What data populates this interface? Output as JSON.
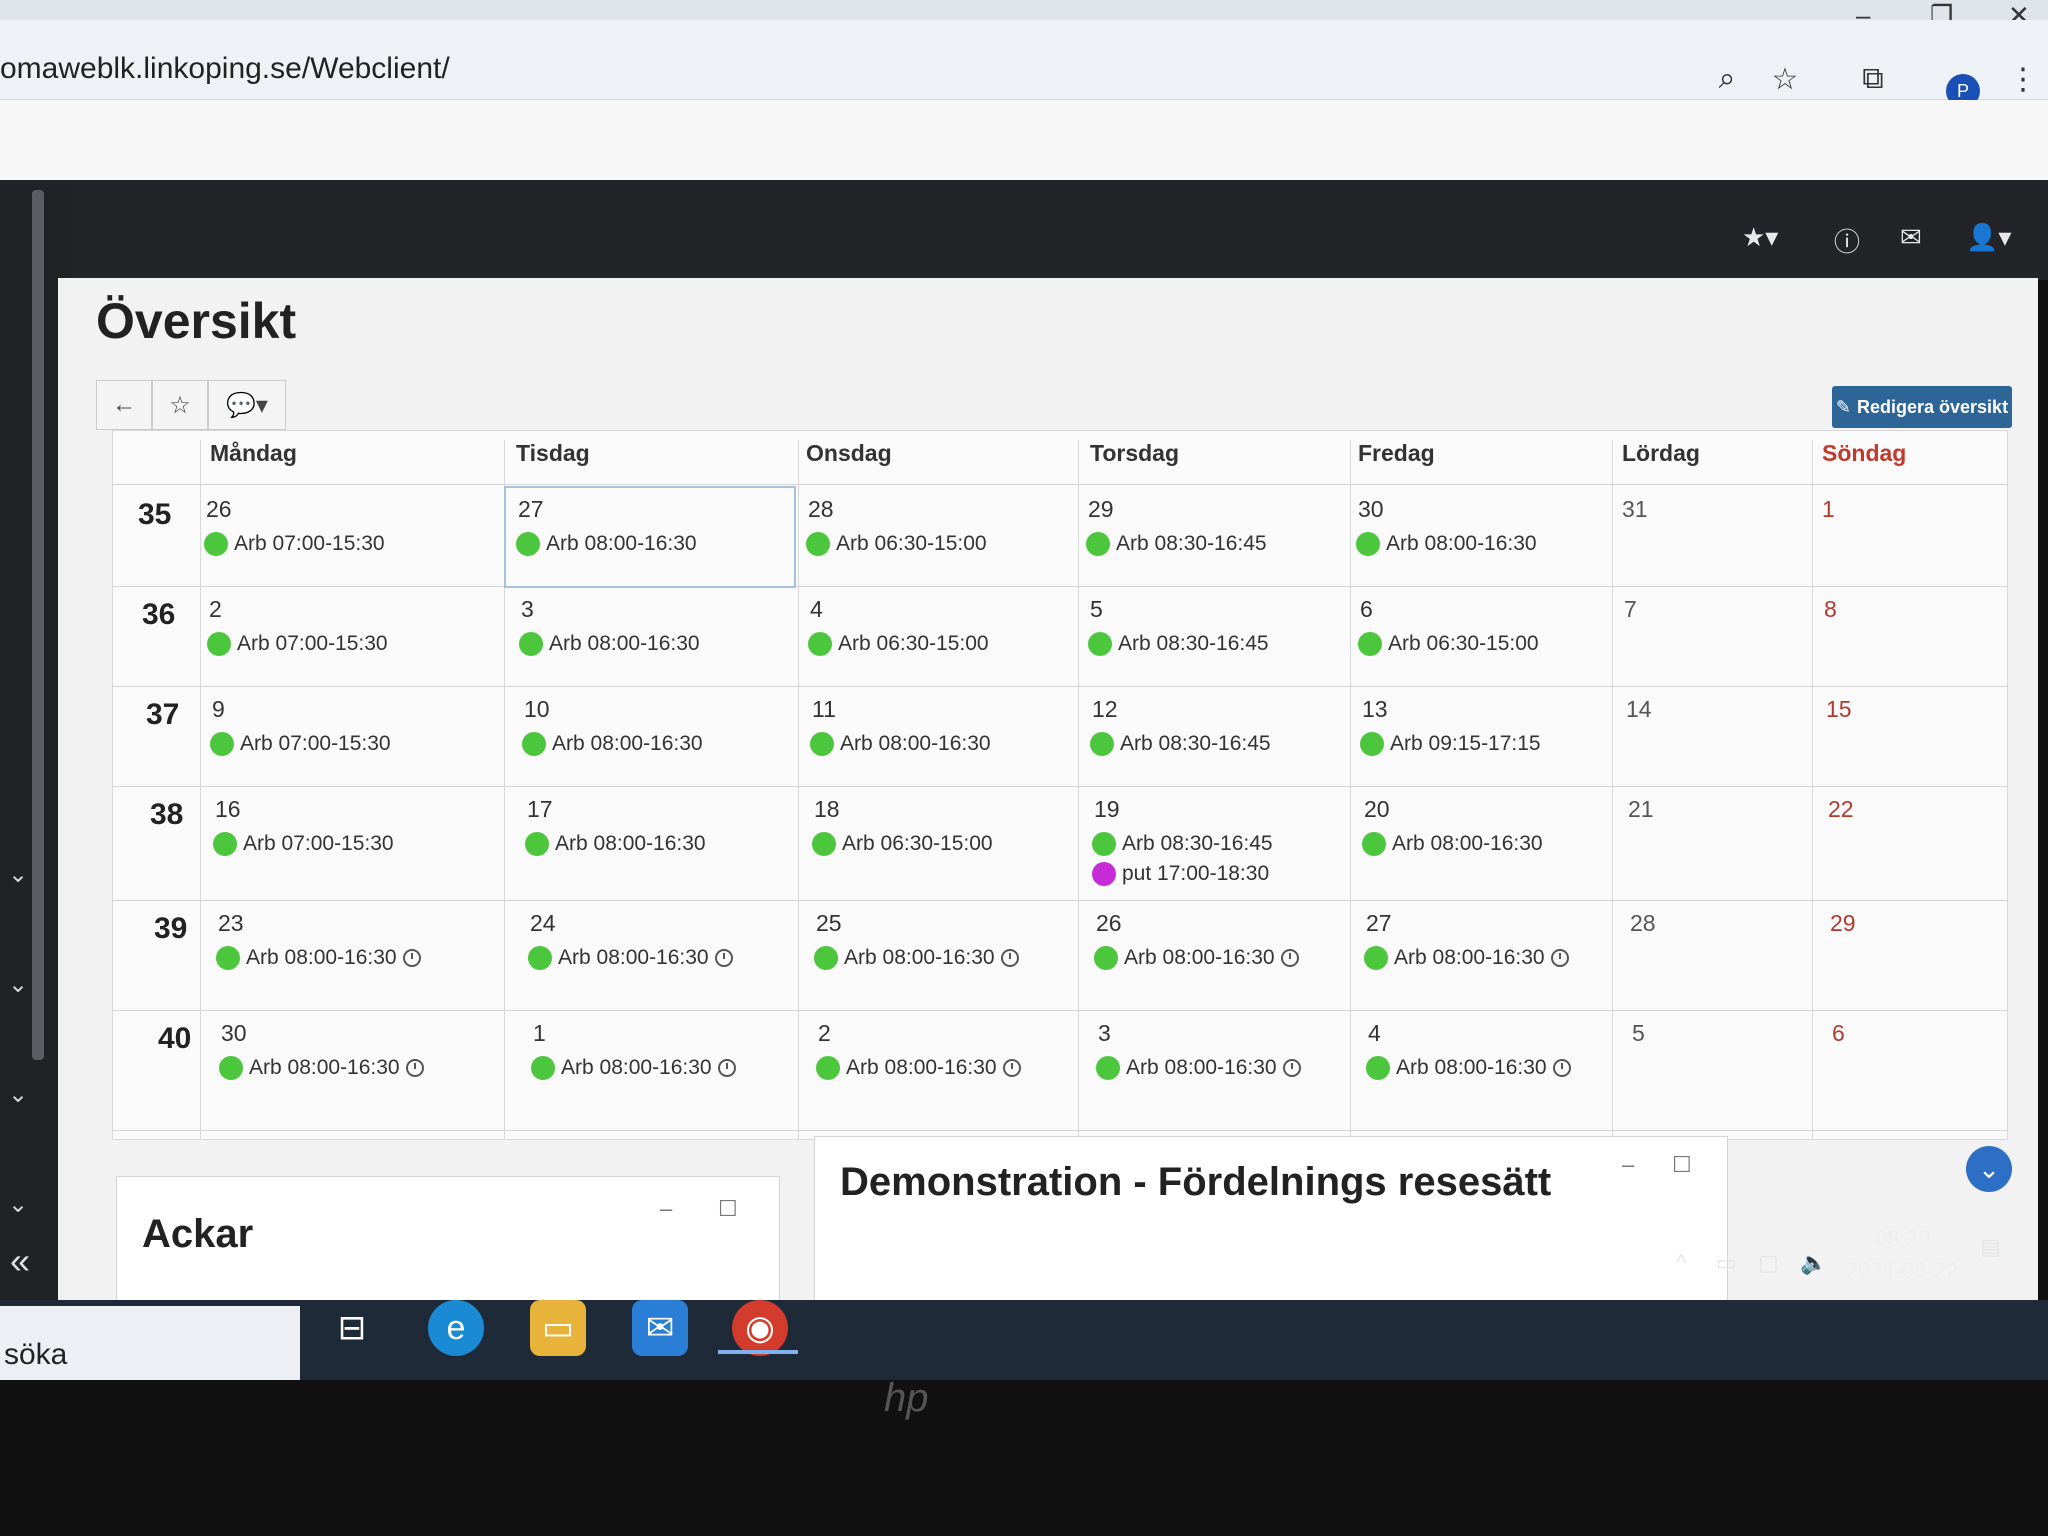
{
  "browser": {
    "url": "omaweblk.linkoping.se/Webclient/",
    "profile_initial": "P"
  },
  "page": {
    "title": "Översikt",
    "edit_label": "Redigera översikt"
  },
  "calendar": {
    "days": [
      "Måndag",
      "Tisdag",
      "Onsdag",
      "Torsdag",
      "Fredag",
      "Lördag",
      "Söndag"
    ],
    "weeks": [
      {
        "week": "35",
        "days": [
          {
            "n": "26",
            "shifts": [
              {
                "t": "Arb 07:00-15:30"
              }
            ]
          },
          {
            "n": "27",
            "shifts": [
              {
                "t": "Arb 08:00-16:30"
              }
            ]
          },
          {
            "n": "28",
            "shifts": [
              {
                "t": "Arb 06:30-15:00"
              }
            ]
          },
          {
            "n": "29",
            "shifts": [
              {
                "t": "Arb 08:30-16:45"
              }
            ]
          },
          {
            "n": "30",
            "shifts": [
              {
                "t": "Arb 08:00-16:30"
              }
            ]
          },
          {
            "n": "31",
            "shifts": []
          },
          {
            "n": "1",
            "shifts": []
          }
        ]
      },
      {
        "week": "36",
        "days": [
          {
            "n": "2",
            "shifts": [
              {
                "t": "Arb 07:00-15:30"
              }
            ]
          },
          {
            "n": "3",
            "shifts": [
              {
                "t": "Arb 08:00-16:30"
              }
            ]
          },
          {
            "n": "4",
            "shifts": [
              {
                "t": "Arb 06:30-15:00"
              }
            ]
          },
          {
            "n": "5",
            "shifts": [
              {
                "t": "Arb 08:30-16:45"
              }
            ]
          },
          {
            "n": "6",
            "shifts": [
              {
                "t": "Arb 06:30-15:00"
              }
            ]
          },
          {
            "n": "7",
            "shifts": []
          },
          {
            "n": "8",
            "shifts": []
          }
        ]
      },
      {
        "week": "37",
        "days": [
          {
            "n": "9",
            "shifts": [
              {
                "t": "Arb 07:00-15:30"
              }
            ]
          },
          {
            "n": "10",
            "shifts": [
              {
                "t": "Arb 08:00-16:30"
              }
            ]
          },
          {
            "n": "11",
            "shifts": [
              {
                "t": "Arb 08:00-16:30"
              }
            ]
          },
          {
            "n": "12",
            "shifts": [
              {
                "t": "Arb 08:30-16:45"
              }
            ]
          },
          {
            "n": "13",
            "shifts": [
              {
                "t": "Arb 09:15-17:15"
              }
            ]
          },
          {
            "n": "14",
            "shifts": []
          },
          {
            "n": "15",
            "shifts": []
          }
        ]
      },
      {
        "week": "38",
        "days": [
          {
            "n": "16",
            "shifts": [
              {
                "t": "Arb 07:00-15:30"
              }
            ]
          },
          {
            "n": "17",
            "shifts": [
              {
                "t": "Arb 08:00-16:30"
              }
            ]
          },
          {
            "n": "18",
            "shifts": [
              {
                "t": "Arb 06:30-15:00"
              }
            ]
          },
          {
            "n": "19",
            "shifts": [
              {
                "t": "Arb 08:30-16:45"
              },
              {
                "t": "put 17:00-18:30",
                "purple": true
              }
            ]
          },
          {
            "n": "20",
            "shifts": [
              {
                "t": "Arb 08:00-16:30"
              }
            ]
          },
          {
            "n": "21",
            "shifts": []
          },
          {
            "n": "22",
            "shifts": []
          }
        ]
      },
      {
        "week": "39",
        "days": [
          {
            "n": "23",
            "shifts": [
              {
                "t": "Arb 08:00-16:30",
                "clock": true
              }
            ]
          },
          {
            "n": "24",
            "shifts": [
              {
                "t": "Arb 08:00-16:30",
                "clock": true
              }
            ]
          },
          {
            "n": "25",
            "shifts": [
              {
                "t": "Arb 08:00-16:30",
                "clock": true
              }
            ]
          },
          {
            "n": "26",
            "shifts": [
              {
                "t": "Arb 08:00-16:30",
                "clock": true
              }
            ]
          },
          {
            "n": "27",
            "shifts": [
              {
                "t": "Arb 08:00-16:30",
                "clock": true
              }
            ]
          },
          {
            "n": "28",
            "shifts": []
          },
          {
            "n": "29",
            "shifts": []
          }
        ]
      },
      {
        "week": "40",
        "days": [
          {
            "n": "30",
            "shifts": [
              {
                "t": "Arb 08:00-16:30",
                "clock": true
              }
            ]
          },
          {
            "n": "1",
            "shifts": [
              {
                "t": "Arb 08:00-16:30",
                "clock": true
              }
            ]
          },
          {
            "n": "2",
            "shifts": [
              {
                "t": "Arb 08:00-16:30",
                "clock": true
              }
            ]
          },
          {
            "n": "3",
            "shifts": [
              {
                "t": "Arb 08:00-16:30",
                "clock": true
              }
            ]
          },
          {
            "n": "4",
            "shifts": [
              {
                "t": "Arb 08:00-16:30",
                "clock": true
              }
            ]
          },
          {
            "n": "5",
            "shifts": []
          },
          {
            "n": "6",
            "shifts": []
          }
        ]
      }
    ]
  },
  "widgets": {
    "ackar_title": "Ackar",
    "demo_title": "Demonstration - Fördelnings resesätt"
  },
  "taskbar": {
    "search_text": "söka",
    "time": "08:29",
    "date": "2024-08-22"
  }
}
